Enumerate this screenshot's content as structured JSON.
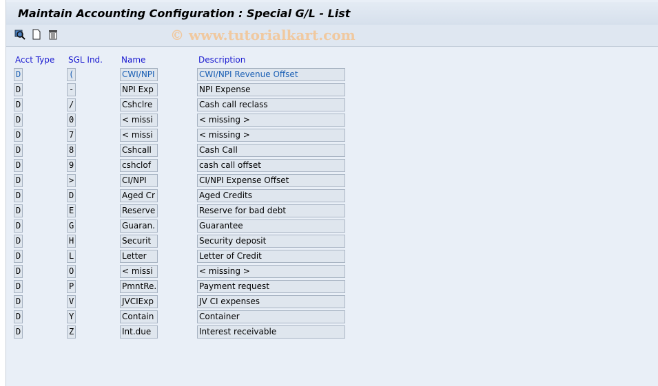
{
  "title": "Maintain Accounting Configuration : Special G/L - List",
  "watermark": "© www.tutorialkart.com",
  "toolbar": {
    "icons": [
      "details-icon",
      "new-entry-icon",
      "delete-icon"
    ]
  },
  "columns": {
    "acct_type": "Acct Type",
    "sgl_ind": "SGL Ind.",
    "name": "Name",
    "description": "Description"
  },
  "rows": [
    {
      "acct": "D",
      "sgl": "(",
      "name": "CWI/NPI",
      "desc": "CWI/NPI Revenue Offset"
    },
    {
      "acct": "D",
      "sgl": "-",
      "name": "NPI Exp",
      "desc": "NPI Expense"
    },
    {
      "acct": "D",
      "sgl": "/",
      "name": "Cshclre",
      "desc": "Cash call reclass"
    },
    {
      "acct": "D",
      "sgl": "0",
      "name": "< missi",
      "desc": "< missing >"
    },
    {
      "acct": "D",
      "sgl": "7",
      "name": "< missi",
      "desc": "< missing >"
    },
    {
      "acct": "D",
      "sgl": "8",
      "name": "Cshcall",
      "desc": "Cash Call"
    },
    {
      "acct": "D",
      "sgl": "9",
      "name": "cshclof",
      "desc": "cash call offset"
    },
    {
      "acct": "D",
      "sgl": ">",
      "name": "CI/NPI",
      "desc": "CI/NPI Expense Offset"
    },
    {
      "acct": "D",
      "sgl": "D",
      "name": "Aged Cr",
      "desc": "Aged Credits"
    },
    {
      "acct": "D",
      "sgl": "E",
      "name": "Reserve",
      "desc": "Reserve for bad debt"
    },
    {
      "acct": "D",
      "sgl": "G",
      "name": "Guaran.",
      "desc": "Guarantee"
    },
    {
      "acct": "D",
      "sgl": "H",
      "name": "Securit",
      "desc": "Security deposit"
    },
    {
      "acct": "D",
      "sgl": "L",
      "name": "Letter",
      "desc": "Letter of Credit"
    },
    {
      "acct": "D",
      "sgl": "O",
      "name": "< missi",
      "desc": "< missing >"
    },
    {
      "acct": "D",
      "sgl": "P",
      "name": "PmntRe...",
      "desc": "Payment request"
    },
    {
      "acct": "D",
      "sgl": "V",
      "name": "JVCIExp",
      "desc": "JV CI expenses"
    },
    {
      "acct": "D",
      "sgl": "Y",
      "name": "Contain",
      "desc": "Container"
    },
    {
      "acct": "D",
      "sgl": "Z",
      "name": "Int.due",
      "desc": "Interest receivable"
    }
  ]
}
